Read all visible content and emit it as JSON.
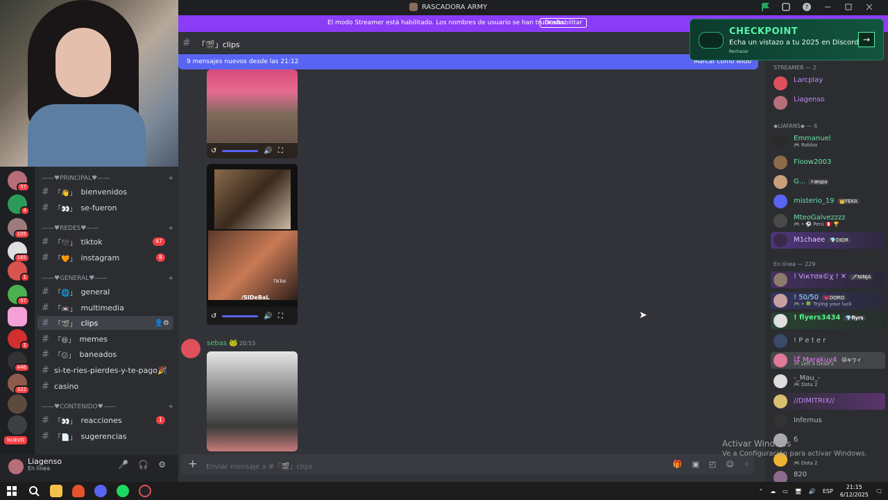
{
  "window": {
    "title": "RASCADORA ARMY"
  },
  "banner": {
    "text": "El modo Streamer está habilitado. Los nombres de usuario se han truncado.",
    "button": "Deshabilitar"
  },
  "channel_header": {
    "name": "「🎬」clips"
  },
  "new_messages": {
    "text": "9 mensajes nuevos desde las 21:12",
    "mark_read": "Marcar como leído"
  },
  "checkpoint": {
    "title": "CHECKPOINT",
    "subtitle": "Echa un vistazo a tu 2025 en Discord",
    "reject": "Rechazar"
  },
  "servers": [
    {
      "badge": "57"
    },
    {
      "badge": "4"
    },
    {
      "badge": "105"
    },
    {
      "badge": "165"
    },
    {
      "badge": "1"
    },
    {
      "badge": "57"
    },
    {
      "badge": ""
    },
    {
      "badge": "1"
    },
    {
      "badge": "446"
    },
    {
      "badge": "322"
    },
    {
      "badge": ""
    },
    {
      "badge": ""
    }
  ],
  "server_new_label": "NUEVO",
  "categories": {
    "principal": "——♥PRINCIPAL♥——",
    "redes": "——♥REDES♥——",
    "general": "——♥GENERAL♥——",
    "contenido": "——♥CONTENIDO♥——"
  },
  "channels": [
    {
      "name": "bienvenidos",
      "emoji": "「👋」",
      "badge": ""
    },
    {
      "name": "se-fueron",
      "emoji": "「👀」",
      "badge": ""
    },
    {
      "name": "tiktok",
      "emoji": "「🖤」",
      "badge": "47"
    },
    {
      "name": "instagram",
      "emoji": "「🧡」",
      "badge": "8"
    },
    {
      "name": "general",
      "emoji": "「🌐」",
      "badge": ""
    },
    {
      "name": "multimedia",
      "emoji": "「📼」",
      "badge": ""
    },
    {
      "name": "clips",
      "emoji": "「🎬」",
      "badge": ""
    },
    {
      "name": "memes",
      "emoji": "「😆」",
      "badge": ""
    },
    {
      "name": "baneados",
      "emoji": "「😕」",
      "badge": ""
    },
    {
      "name": "si-te-ries-pierdes-y-te-pago🎉",
      "emoji": "",
      "badge": ""
    },
    {
      "name": "casino",
      "emoji": "",
      "badge": ""
    },
    {
      "name": "reacciones",
      "emoji": "「👀」",
      "badge": "1"
    },
    {
      "name": "sugerencias",
      "emoji": "「📄」",
      "badge": ""
    }
  ],
  "user": {
    "name": "Liagenso",
    "status": "En línea"
  },
  "message": {
    "author": "sebas 🐸",
    "time": "20:53"
  },
  "video_overlay_text": "/SIDeBaL",
  "tiktok_label": "TikTok",
  "composer": {
    "placeholder": "Enviar mensaje a #「🎬」clips"
  },
  "members": {
    "streamer_header": "STREAMER — 2",
    "liafans_header": "◆LIAFANS◆ — 6",
    "online_header": "En línea — 229",
    "streamers": [
      {
        "name": "Larcplay",
        "sub": "",
        "color": "#c08cf5"
      },
      {
        "name": "Liagenso",
        "sub": "",
        "color": "#c08cf5"
      }
    ],
    "liafans": [
      {
        "name": "Emmanuel",
        "sub": "🎮 Roblox",
        "tag": ""
      },
      {
        "name": "Floow2003",
        "sub": "",
        "tag": ""
      },
      {
        "name": "G...",
        "sub": "",
        "tag": "⚡æspa"
      },
      {
        "name": "misterio_19",
        "sub": "",
        "tag": "👑FEKA"
      },
      {
        "name": "MteoGalvezzzz",
        "sub": "🎮 • ⚽ Perú 🇵🇪 🏆",
        "tag": ""
      },
      {
        "name": "M1chaee",
        "sub": "",
        "tag": "💎DIOR"
      }
    ],
    "online": [
      {
        "name": "! Vιктσя©χ ! ✕",
        "sub": "",
        "tag": "🗡NINJA",
        "color": "#d3a6ff"
      },
      {
        "name": "! 50/50",
        "sub": "🎮 • 🍀 Trying your luck",
        "tag": "💗DORO",
        "color": "#a6e3ff"
      },
      {
        "name": "! flyers3434",
        "sub": "",
        "tag": "💎flyrs",
        "color": "#57f287"
      },
      {
        "name": "! P e t e r",
        "sub": "",
        "tag": "",
        "color": "#b5bac1"
      },
      {
        "name": "ぱ Marakuy4",
        "sub": "🎮 Left 4 Dead 2",
        "tag": "🐱キウイ",
        "color": "#f47fff"
      },
      {
        "name": "-_Mau_-",
        "sub": "🎮 Dota 2",
        "tag": "",
        "color": "#b5bac1"
      },
      {
        "name": "//DIMITRIX//",
        "sub": "",
        "tag": "",
        "color": "#c08cf5"
      },
      {
        "name": "Infernus",
        "sub": "",
        "tag": "",
        "color": "#b5bac1"
      },
      {
        "name": "б",
        "sub": "",
        "tag": "",
        "color": "#b5bac1"
      },
      {
        "name": "",
        "sub": "🎮 Dota 2",
        "tag": "",
        "color": "#b5bac1"
      },
      {
        "name": "820",
        "sub": "",
        "tag": "",
        "color": "#b5bac1"
      }
    ]
  },
  "watermark": {
    "line1": "Activar Windows",
    "line2": "Ve a Configuración para activar Windows."
  },
  "taskbar": {
    "lang": "ESP",
    "time": "21:15",
    "date": "6/12/2025"
  }
}
